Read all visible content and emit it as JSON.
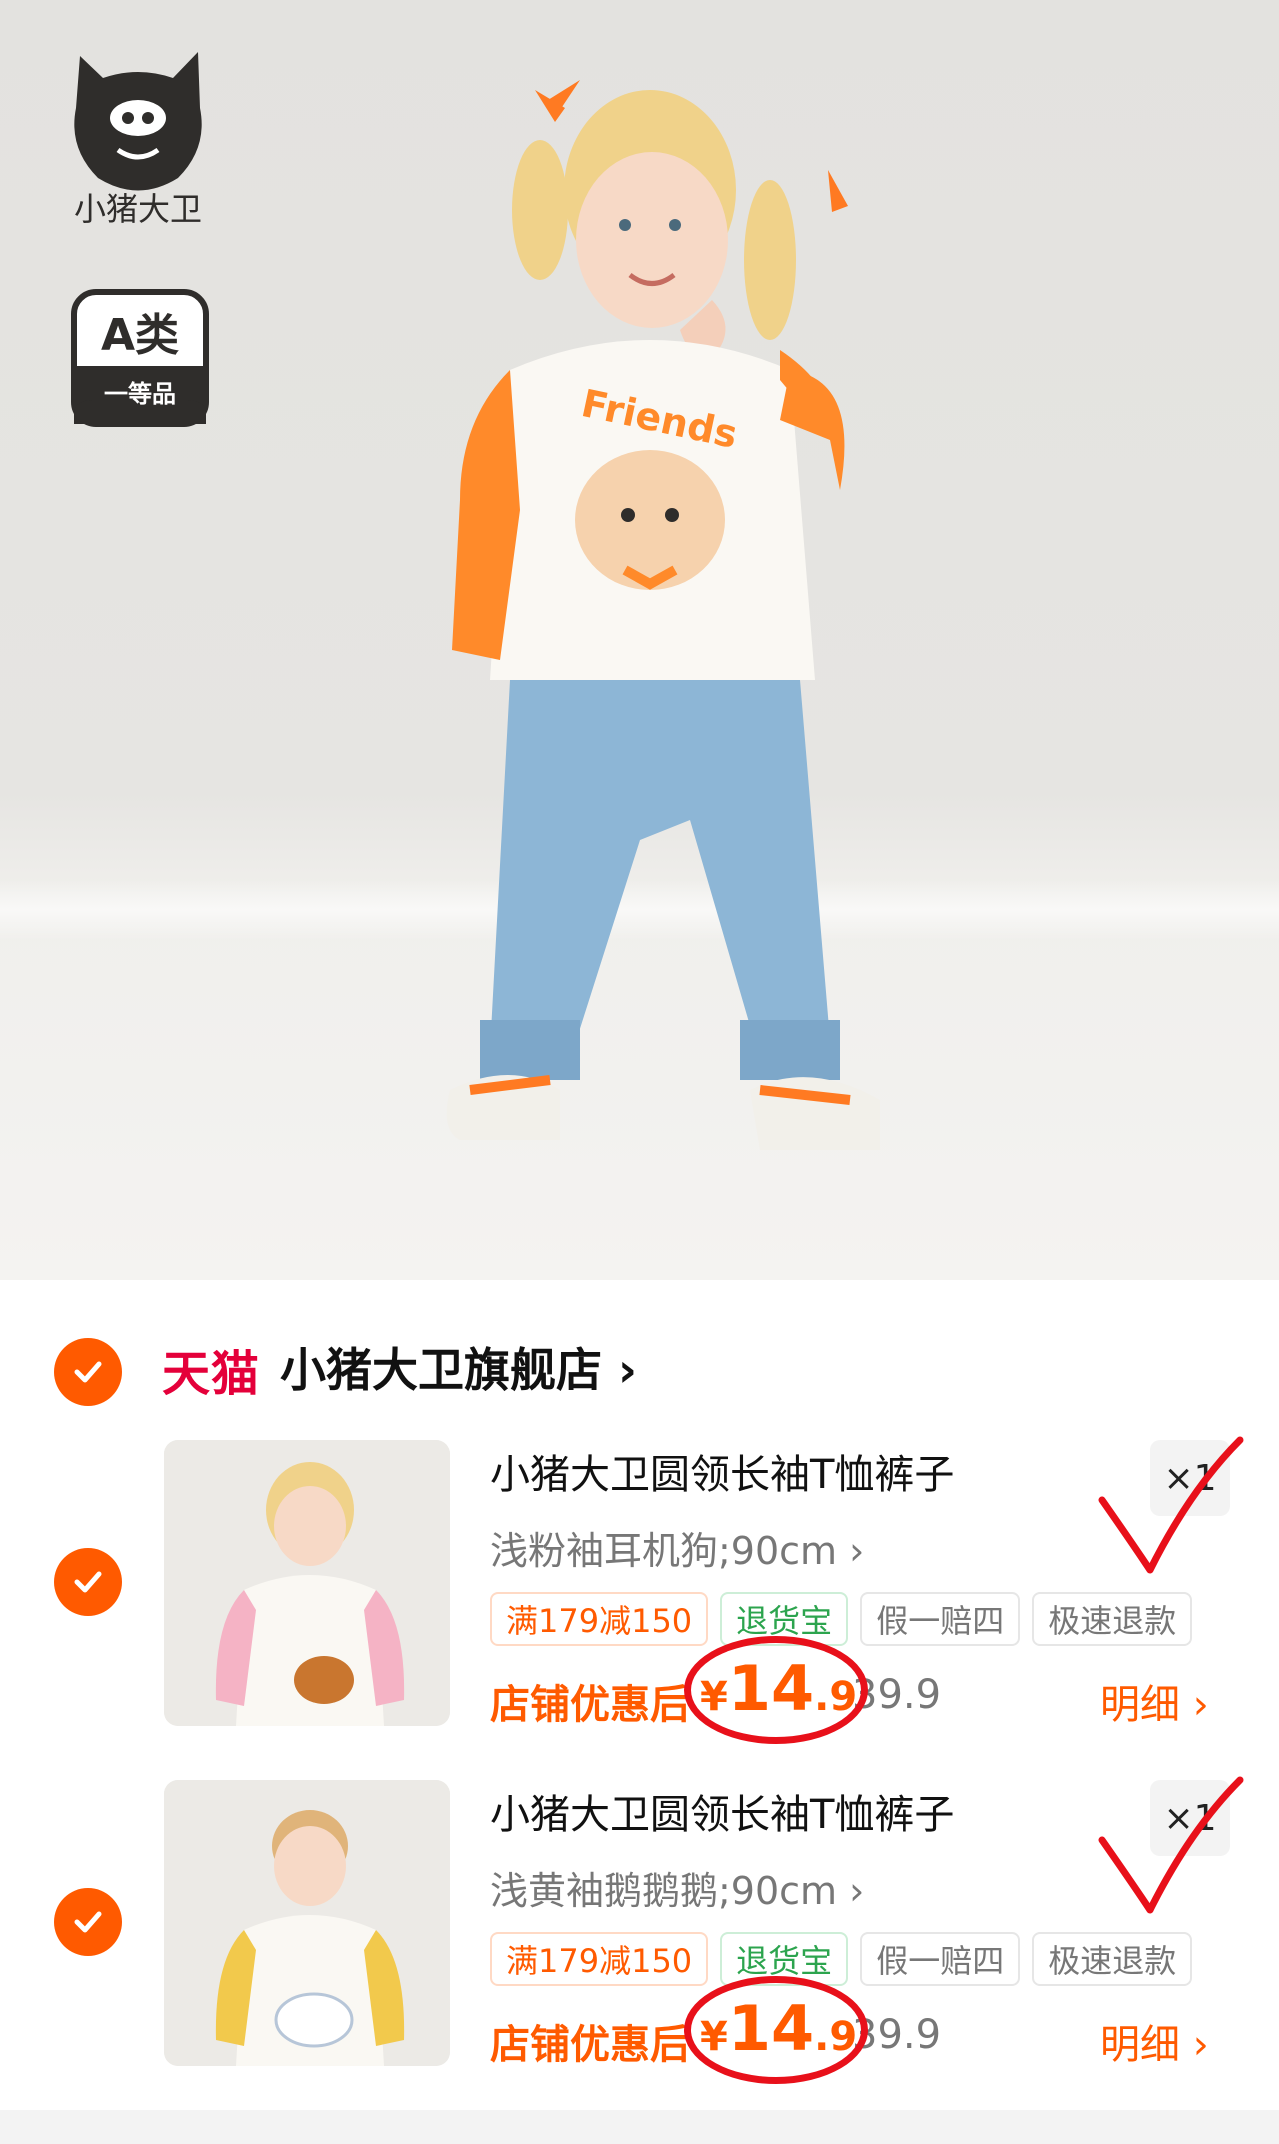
{
  "brand": {
    "logo_text": "小猪大卫",
    "grade_badge_top": "A类",
    "grade_badge_bottom": "一等品"
  },
  "store": {
    "platform": "天猫",
    "name": "小猪大卫旗舰店",
    "arrow": "›"
  },
  "items": [
    {
      "title": "小猪大卫圆领长袖T恤裤子",
      "quantity": "×1",
      "sku": "浅粉袖耳机狗;90cm",
      "sku_arrow": "›",
      "tags": [
        "满179减150",
        "退货宝",
        "假一赔四",
        "极速退款"
      ],
      "promo_label": "店铺优惠后",
      "price_currency": "¥",
      "price_integer": "14",
      "price_decimal": ".9",
      "original_price": "39.9",
      "detail_label": "明细",
      "detail_arrow": "›",
      "sleeve_color": "#f5b3c5"
    },
    {
      "title": "小猪大卫圆领长袖T恤裤子",
      "quantity": "×1",
      "sku": "浅黄袖鹅鹅鹅;90cm",
      "sku_arrow": "›",
      "tags": [
        "满179减150",
        "退货宝",
        "假一赔四",
        "极速退款"
      ],
      "promo_label": "店铺优惠后",
      "price_currency": "¥",
      "price_integer": "14",
      "price_decimal": ".9",
      "original_price": "39.9",
      "detail_label": "明细",
      "detail_arrow": "›",
      "sleeve_color": "#f2c94c"
    }
  ],
  "colors": {
    "accent": "#ff5a00",
    "tmall": "#e4003a",
    "annotation": "#e8101a"
  }
}
